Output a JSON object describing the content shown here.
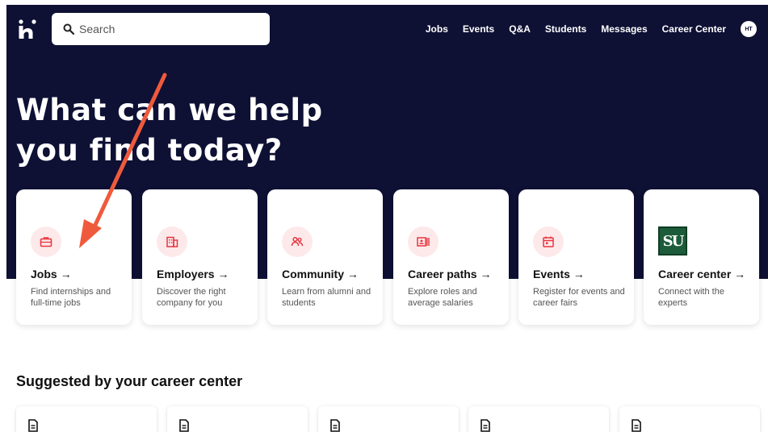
{
  "header": {
    "search_placeholder": "Search",
    "nav": [
      "Jobs",
      "Events",
      "Q&A",
      "Students",
      "Messages",
      "Career Center"
    ],
    "avatar_initials": "HT"
  },
  "hero": {
    "line1": "What can we help",
    "line2": "you find today?"
  },
  "cards": [
    {
      "title": "Jobs →",
      "desc": "Find internships and full-time jobs",
      "icon": "briefcase-icon"
    },
    {
      "title": "Employers →",
      "desc": "Discover the right company for you",
      "icon": "building-icon"
    },
    {
      "title": "Community →",
      "desc": "Learn from alumni and students",
      "icon": "people-icon"
    },
    {
      "title": "Career paths →",
      "desc": "Explore roles and average salaries",
      "icon": "id-card-icon"
    },
    {
      "title": "Events →",
      "desc": "Register for events and career fairs",
      "icon": "calendar-icon"
    },
    {
      "title": "Career center →",
      "desc": "Connect with the experts",
      "icon": "su-logo"
    }
  ],
  "su_logo_text": "SU",
  "section_title": "Suggested by your career center",
  "colors": {
    "hero_bg": "#0e1034",
    "accent_red": "#e8353f",
    "badge_bg": "#fde9ea",
    "annotation_arrow": "#ef5a3c"
  }
}
